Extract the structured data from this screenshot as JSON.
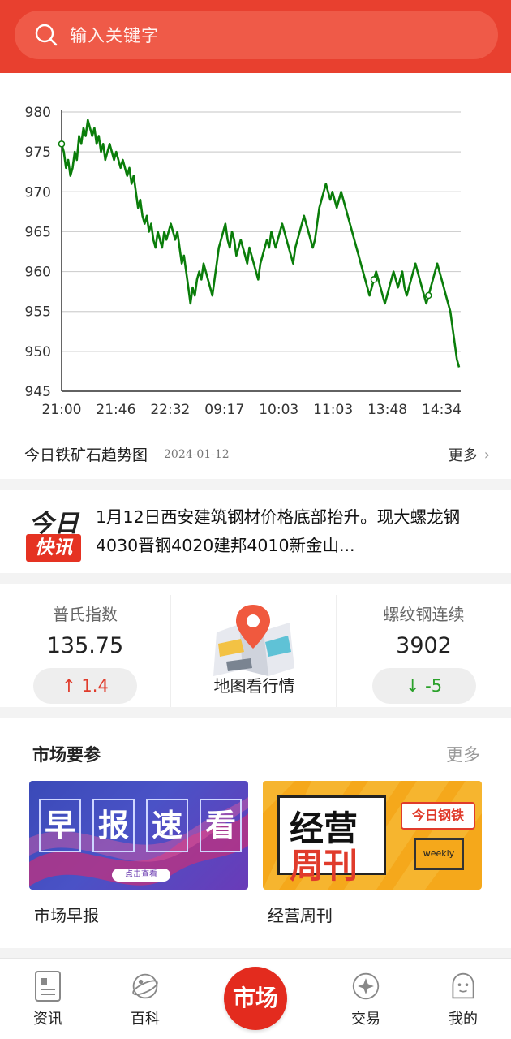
{
  "search": {
    "placeholder": "输入关键字"
  },
  "chart_data": {
    "type": "line",
    "x_ticks": [
      "21:00",
      "21:46",
      "22:32",
      "09:17",
      "10:03",
      "11:03",
      "13:48",
      "14:34"
    ],
    "y_ticks": [
      945,
      950,
      955,
      960,
      965,
      970,
      975,
      980
    ],
    "ylim": [
      945,
      980
    ],
    "grid": true,
    "series": [
      {
        "color": "#0a7d0a",
        "values": [
          976,
          975,
          973,
          974,
          972,
          973,
          975,
          974,
          977,
          976,
          978,
          977,
          979,
          978,
          977,
          978,
          976,
          977,
          975,
          976,
          974,
          975,
          976,
          975,
          974,
          975,
          974,
          973,
          974,
          973,
          972,
          973,
          971,
          972,
          970,
          968,
          969,
          967,
          966,
          967,
          965,
          966,
          964,
          963,
          965,
          964,
          963,
          965,
          964,
          965,
          966,
          965,
          964,
          965,
          963,
          961,
          962,
          960,
          958,
          956,
          958,
          957,
          959,
          960,
          959,
          961,
          960,
          959,
          958,
          957,
          959,
          961,
          963,
          964,
          965,
          966,
          964,
          963,
          965,
          964,
          962,
          963,
          964,
          963,
          962,
          961,
          963,
          962,
          961,
          960,
          959,
          961,
          962,
          963,
          964,
          963,
          965,
          964,
          963,
          964,
          965,
          966,
          965,
          964,
          963,
          962,
          961,
          963,
          964,
          965,
          966,
          967,
          966,
          965,
          964,
          963,
          964,
          966,
          968,
          969,
          970,
          971,
          970,
          969,
          970,
          969,
          968,
          969,
          970,
          969,
          968,
          967,
          966,
          965,
          964,
          963,
          962,
          961,
          960,
          959,
          958,
          957,
          958,
          959,
          960,
          959,
          958,
          957,
          956,
          957,
          958,
          959,
          960,
          959,
          958,
          959,
          960,
          958,
          957,
          958,
          959,
          960,
          961,
          960,
          959,
          958,
          957,
          956,
          957,
          958,
          959,
          960,
          961,
          960,
          959,
          958,
          957,
          956,
          955,
          953,
          951,
          949,
          948
        ]
      }
    ]
  },
  "chart_footer": {
    "title": "今日铁矿石趋势图",
    "date": "2024-01-12",
    "more": "更多",
    "chevron": "›"
  },
  "news": {
    "logo_top": "今日",
    "logo_bottom": "快讯",
    "text": "1月12日西安建筑钢材价格底部抬升。现大螺龙钢4030晋钢4020建邦4010新金山..."
  },
  "indices": {
    "left": {
      "name": "普氏指数",
      "value": "135.75",
      "change": "↑ 1.4"
    },
    "middle": {
      "label": "地图看行情"
    },
    "right": {
      "name": "螺纹钢连续",
      "value": "3902",
      "change": "↓ -5"
    },
    "colors": {
      "up": "#e03b2b",
      "down": "#2aa12a"
    }
  },
  "market": {
    "title": "市场要参",
    "more": "更多",
    "banners": [
      {
        "chars": [
          "早",
          "报",
          "速",
          "看"
        ],
        "button": "点击查看",
        "caption": "市场早报"
      },
      {
        "line1": "经营",
        "line2": "周刊",
        "tag": "今日钢铁",
        "tv": "weekly",
        "caption": "经营周刊"
      }
    ]
  },
  "nav": {
    "items": [
      {
        "label": "资讯",
        "icon": "news-icon"
      },
      {
        "label": "百科",
        "icon": "planet-icon"
      },
      {
        "label": "市场",
        "icon": "market-center"
      },
      {
        "label": "交易",
        "icon": "trade-icon"
      },
      {
        "label": "我的",
        "icon": "profile-icon"
      }
    ]
  },
  "theme": {
    "brand": "#e8402f",
    "chart_line": "#0a7d0a"
  }
}
